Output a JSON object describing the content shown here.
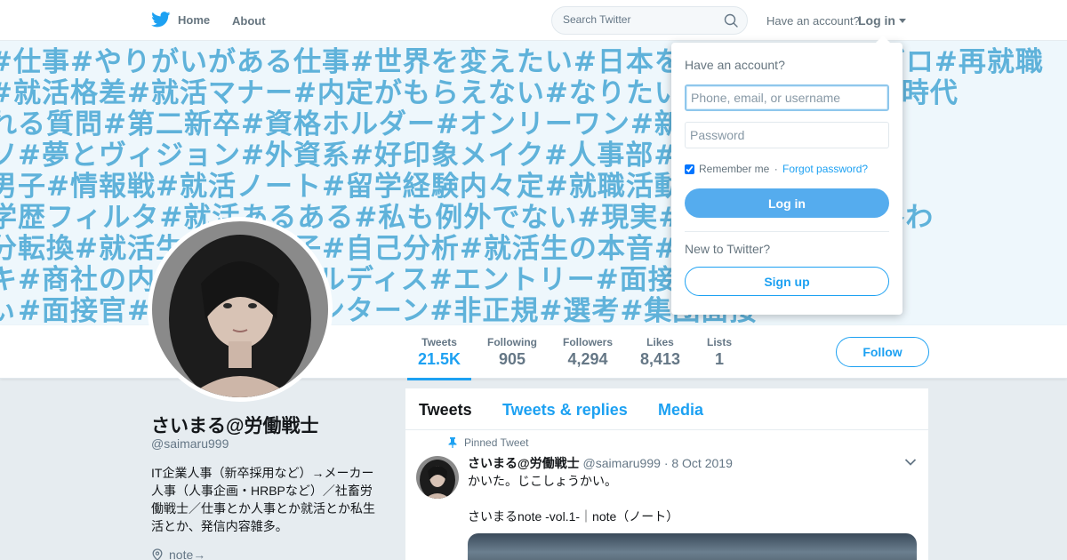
{
  "colors": {
    "accent": "#1da1f2",
    "banner_text": "#5fb2da",
    "banner_bg": "#eef7fc",
    "page_bg": "#e6ecf0",
    "muted": "#657786"
  },
  "topnav": {
    "home_label": "Home",
    "about_label": "About",
    "search_placeholder": "Search Twitter",
    "have_account": "Have an account?",
    "login_label": "Log in"
  },
  "banner": {
    "rows": [
      "#仕事#やりがいがある仕事#世界を変えたい#日本を元気にしたい#ゼロ#再就職",
      "#就活格差#就活マナー#内定がもらえない#なりたい自分#一歩#学生時代",
      "れる質問#第二新卒#資格ホルダー#オンリーワン#新卒一括採用#マッ",
      "ソ#夢とヴィジョン#外資系#好印象メイク#人事部#内定を取れる人",
      "男子#情報戦#就活ノート#留学経験内々定#就職活動#就職勝ち組",
      "学歴フィルタ#就活あるある#私も例外でない#現実#あるある#就活終わ",
      "分転換#就活生#就活女子#自己分析#就活生の本音#ハッカツ#イン",
      "キ#商社の内定#就活#グルディス#エントリー#面接落ちた#ブラ",
      "ぃ#面接官#業界研究#インターン#非正規#選考#集団面接"
    ]
  },
  "profile": {
    "name": "さいまる@労働戦士",
    "handle": "@saimaru999",
    "bio": "IT企業人事（新卒採用など）→メーカー人事（人事企画・HRBPなど）／社畜労働戦士／仕事とか人事とか就活とか私生活とか、発信内容雑多。",
    "link": "note→"
  },
  "stats": [
    {
      "label": "Tweets",
      "value": "21.5K"
    },
    {
      "label": "Following",
      "value": "905"
    },
    {
      "label": "Followers",
      "value": "4,294"
    },
    {
      "label": "Likes",
      "value": "8,413"
    },
    {
      "label": "Lists",
      "value": "1"
    }
  ],
  "follow_label": "Follow",
  "tabs": [
    "Tweets",
    "Tweets & replies",
    "Media"
  ],
  "tweet": {
    "pinned_label": "Pinned Tweet",
    "name": "さいまる@労働戦士",
    "handle": "@saimaru999",
    "date": "· 8 Oct 2019",
    "line1": "かいた。じこしょうかい。",
    "line2": "さいまるnote -vol.1-｜note（ノート）"
  },
  "login_dropdown": {
    "title": "Have an account?",
    "username_placeholder": "Phone, email, or username",
    "password_placeholder": "Password",
    "remember_label": "Remember me",
    "separator": " · ",
    "forgot_label": "Forgot password?",
    "login_button": "Log in",
    "new_label": "New to Twitter?",
    "signup_button": "Sign up"
  }
}
